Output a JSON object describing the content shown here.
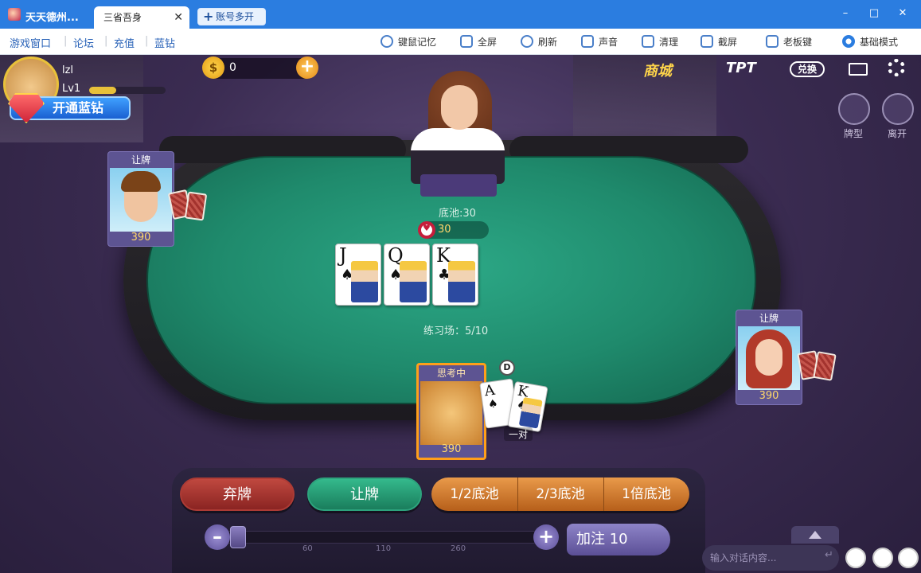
{
  "titlebar": {
    "app_title": "天天德州...",
    "active_tab": "三省吾身",
    "tab_close": "✕",
    "new_tab": "账号多开",
    "new_tab_plus": "+",
    "minimize": "–",
    "maximize": "□",
    "close": "✕"
  },
  "toolbar": {
    "nav": [
      "游戏窗口",
      "论坛",
      "充值",
      "蓝钻"
    ],
    "separator": "|",
    "tools": [
      "键鼠记忆",
      "全屏",
      "刷新",
      "声音",
      "清理",
      "截屏",
      "老板键",
      "基础模式"
    ]
  },
  "profile": {
    "name": "lzl",
    "level": "Lv1",
    "level_progress": 0.35,
    "vip_button": "开通蓝钻"
  },
  "coins": {
    "symbol": "$",
    "value": "0",
    "add": "+"
  },
  "top_right": {
    "shop": "商城",
    "tpt": "TPT",
    "exchange": "兑换",
    "mail_icon": "mail-icon",
    "settings_icon": "gear-icon"
  },
  "side_buttons": {
    "hand_types": "牌型",
    "leave": "离开"
  },
  "table": {
    "pot_label": "底池:30",
    "pot_chip_value": "30",
    "practice": "练习场：5/10",
    "community_cards": [
      {
        "rank": "J",
        "suit": "♠"
      },
      {
        "rank": "Q",
        "suit": "♠"
      },
      {
        "rank": "K",
        "suit": "♣"
      }
    ]
  },
  "players": {
    "left": {
      "status": "让牌",
      "chips": "390"
    },
    "right": {
      "status": "让牌",
      "chips": "390"
    },
    "hero": {
      "status": "思考中",
      "chips": "390",
      "dealer_button": "D",
      "hand_label": "一对",
      "cards": [
        {
          "rank": "A",
          "suit": "♠"
        },
        {
          "rank": "K",
          "suit": "♠"
        }
      ]
    }
  },
  "actions": {
    "fold": "弃牌",
    "check": "让牌",
    "half_pot": "1/2底池",
    "two_thirds_pot": "2/3底池",
    "full_pot": "1倍底池",
    "minus": "–",
    "plus": "+",
    "raise": "加注 10",
    "slider_ticks": [
      "60",
      "110",
      "260"
    ]
  },
  "chat": {
    "placeholder": "输入对话内容...",
    "send": "↵"
  }
}
